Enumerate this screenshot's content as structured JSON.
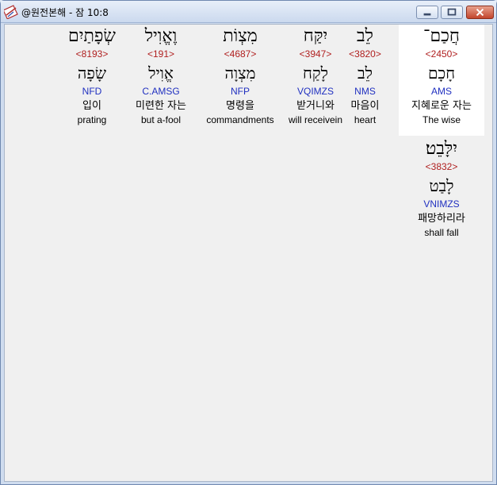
{
  "window": {
    "title": "@원전본해 - 잠 10:8",
    "app_icon": "bible-app-icon",
    "controls": {
      "minimize": "minimize-icon",
      "maximize": "maximize-icon",
      "close": "close-icon"
    }
  },
  "colors": {
    "strong": "#b02020",
    "parse": "#2030c0",
    "selected_bg": "#ffffff",
    "client_bg": "#f0f0f0"
  },
  "words": [
    {
      "hebrew": "חֲכַם־",
      "strong": "<2450>",
      "lemma": "חָכָם",
      "parse": "AMS",
      "korean": "지혜로운 자는",
      "english": "The wise",
      "selected": true
    },
    {
      "hebrew": "לֵב",
      "strong": "<3820>",
      "lemma": "לֵב",
      "parse": "NMS",
      "korean": "마음이",
      "english": "heart",
      "selected": false
    },
    {
      "hebrew": "יִקַּח",
      "strong": "<3947>",
      "lemma": "לָקַח",
      "parse": "VQIMZS",
      "korean": "받거니와",
      "english": "will receivein",
      "selected": false
    },
    {
      "hebrew": "מִצְוֹת",
      "strong": "<4687>",
      "lemma": "מִצְוָה",
      "parse": "NFP",
      "korean": "명령을",
      "english": "commandments",
      "selected": false
    },
    {
      "hebrew": "וֶאֱוִיל",
      "strong": "<191>",
      "lemma": "אֱוִיל",
      "parse": "C.AMSG",
      "korean": "미련한 자는",
      "english": "but a-fool",
      "selected": false
    },
    {
      "hebrew": "שְׂפָתַיִם",
      "strong": "<8193>",
      "lemma": "שָׂפָה",
      "parse": "NFD",
      "korean": "입이",
      "english": "prating",
      "selected": false
    },
    {
      "hebrew": "יִלָּבֵט׃",
      "strong": "<3832>",
      "lemma": "לָבַט",
      "parse": "VNIMZS",
      "korean": "패망하리라",
      "english": "shall fall",
      "selected": false
    }
  ]
}
